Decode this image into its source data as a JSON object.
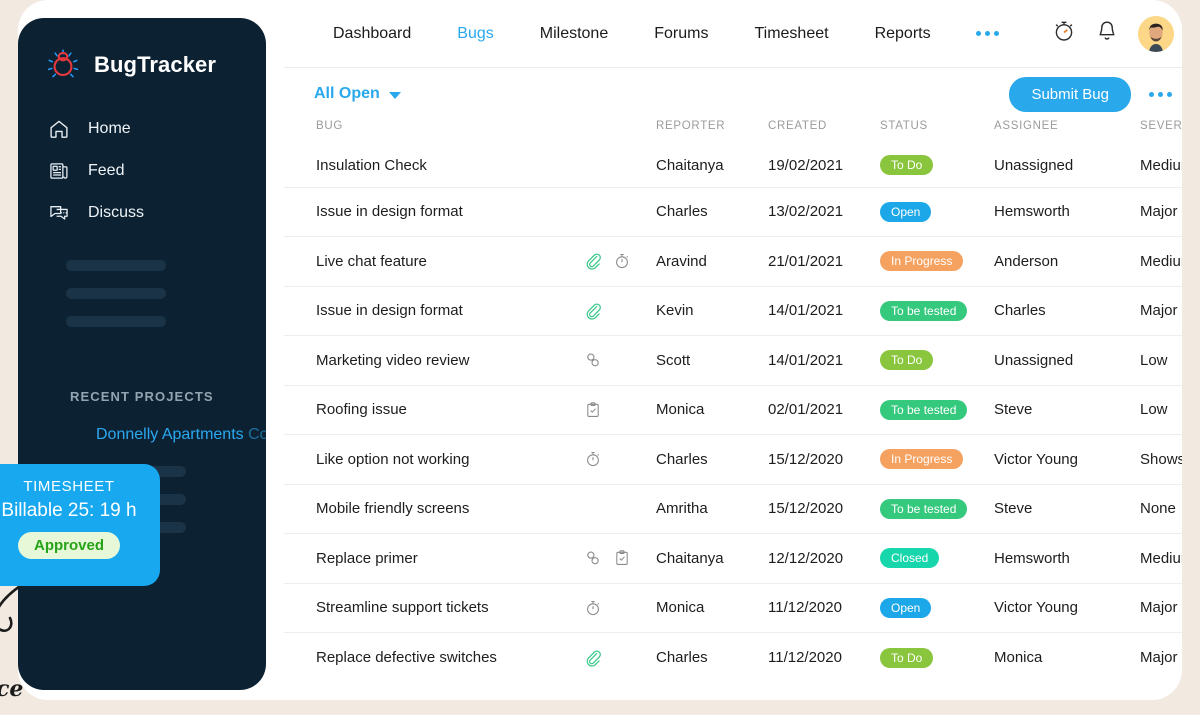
{
  "theme": {
    "page_bg": "#f2e9e1",
    "sidebar_bg": "#0c2233",
    "accent": "#29a8ec",
    "card_bg": "#ffffff"
  },
  "sidebar": {
    "brand": "BugTracker",
    "nav_items": [
      {
        "label": "Home",
        "icon": "home-icon"
      },
      {
        "label": "Feed",
        "icon": "feed-icon"
      },
      {
        "label": "Discuss",
        "icon": "discuss-icon"
      }
    ],
    "recent_projects_title": "RECENT PROJECTS",
    "recent_project": "Donnelly Apartments",
    "recent_project_truncated": " Co"
  },
  "timesheet": {
    "title": "TIMESHEET",
    "value": "Billable  25: 19 h",
    "status": "Approved",
    "annotation": "ce"
  },
  "topnav": {
    "links": [
      {
        "label": "Dashboard",
        "active": false
      },
      {
        "label": "Bugs",
        "active": true
      },
      {
        "label": "Milestone",
        "active": false
      },
      {
        "label": "Forums",
        "active": false
      },
      {
        "label": "Timesheet",
        "active": false
      },
      {
        "label": "Reports",
        "active": false
      }
    ],
    "more_icon": "ellipsis-icon",
    "timer_icon": "stopwatch-icon",
    "bell_icon": "bell-icon",
    "avatar_icon": "user-avatar"
  },
  "toolbar": {
    "filter_label": "All Open",
    "filter_caret_icon": "chevron-down-icon",
    "submit_label": "Submit Bug",
    "more_icon": "ellipsis-icon"
  },
  "table": {
    "columns": [
      "BUG",
      "",
      "REPORTER",
      "CREATED",
      "STATUS",
      "ASSIGNEE",
      "SEVERITY"
    ],
    "status_colors": {
      "To Do": "#8ac53e",
      "Open": "#1ca8e8",
      "In Progress": "#f5a261",
      "To be tested": "#35c97e",
      "Closed": "#18d6ac"
    },
    "rows": [
      {
        "bug": "Insulation Check",
        "icons": [],
        "reporter": "Chaitanya",
        "created": "19/02/2021",
        "status": "To Do",
        "assignee": "Unassigned",
        "severity": "Medium"
      },
      {
        "bug": "Issue in design format",
        "icons": [],
        "reporter": "Charles",
        "created": "13/02/2021",
        "status": "Open",
        "assignee": "Hemsworth",
        "severity": "Major"
      },
      {
        "bug": "Live chat feature",
        "icons": [
          "attachment-green-icon",
          "timer-icon"
        ],
        "reporter": "Aravind",
        "created": "21/01/2021",
        "status": "In Progress",
        "assignee": "Anderson",
        "severity": "Medium"
      },
      {
        "bug": "Issue in design format",
        "icons": [
          "attachment-green-icon"
        ],
        "reporter": "Kevin",
        "created": "14/01/2021",
        "status": "To be tested",
        "assignee": "Charles",
        "severity": "Major"
      },
      {
        "bug": "Marketing video review",
        "icons": [
          "link-icon"
        ],
        "reporter": "Scott",
        "created": "14/01/2021",
        "status": "To Do",
        "assignee": "Unassigned",
        "severity": "Low"
      },
      {
        "bug": "Roofing issue",
        "icons": [
          "clipboard-check-icon"
        ],
        "reporter": "Monica",
        "created": "02/01/2021",
        "status": "To be tested",
        "assignee": "Steve",
        "severity": "Low"
      },
      {
        "bug": "Like option not working",
        "icons": [
          "timer-icon"
        ],
        "reporter": "Charles",
        "created": "15/12/2020",
        "status": "In Progress",
        "assignee": "Victor Young",
        "severity": "Showstopper"
      },
      {
        "bug": "Mobile friendly screens",
        "icons": [],
        "reporter": "Amritha",
        "created": "15/12/2020",
        "status": "To be tested",
        "assignee": "Steve",
        "severity": "None"
      },
      {
        "bug": "Replace primer",
        "icons": [
          "link-icon",
          "clipboard-check-icon"
        ],
        "reporter": "Chaitanya",
        "created": "12/12/2020",
        "status": "Closed",
        "assignee": "Hemsworth",
        "severity": "Medium"
      },
      {
        "bug": "Streamline support tickets",
        "icons": [
          "timer-icon"
        ],
        "reporter": "Monica",
        "created": "11/12/2020",
        "status": "Open",
        "assignee": "Victor Young",
        "severity": "Major"
      },
      {
        "bug": "Replace defective switches",
        "icons": [
          "attachment-green-icon"
        ],
        "reporter": "Charles",
        "created": "11/12/2020",
        "status": "To Do",
        "assignee": "Monica",
        "severity": "Major"
      }
    ]
  }
}
